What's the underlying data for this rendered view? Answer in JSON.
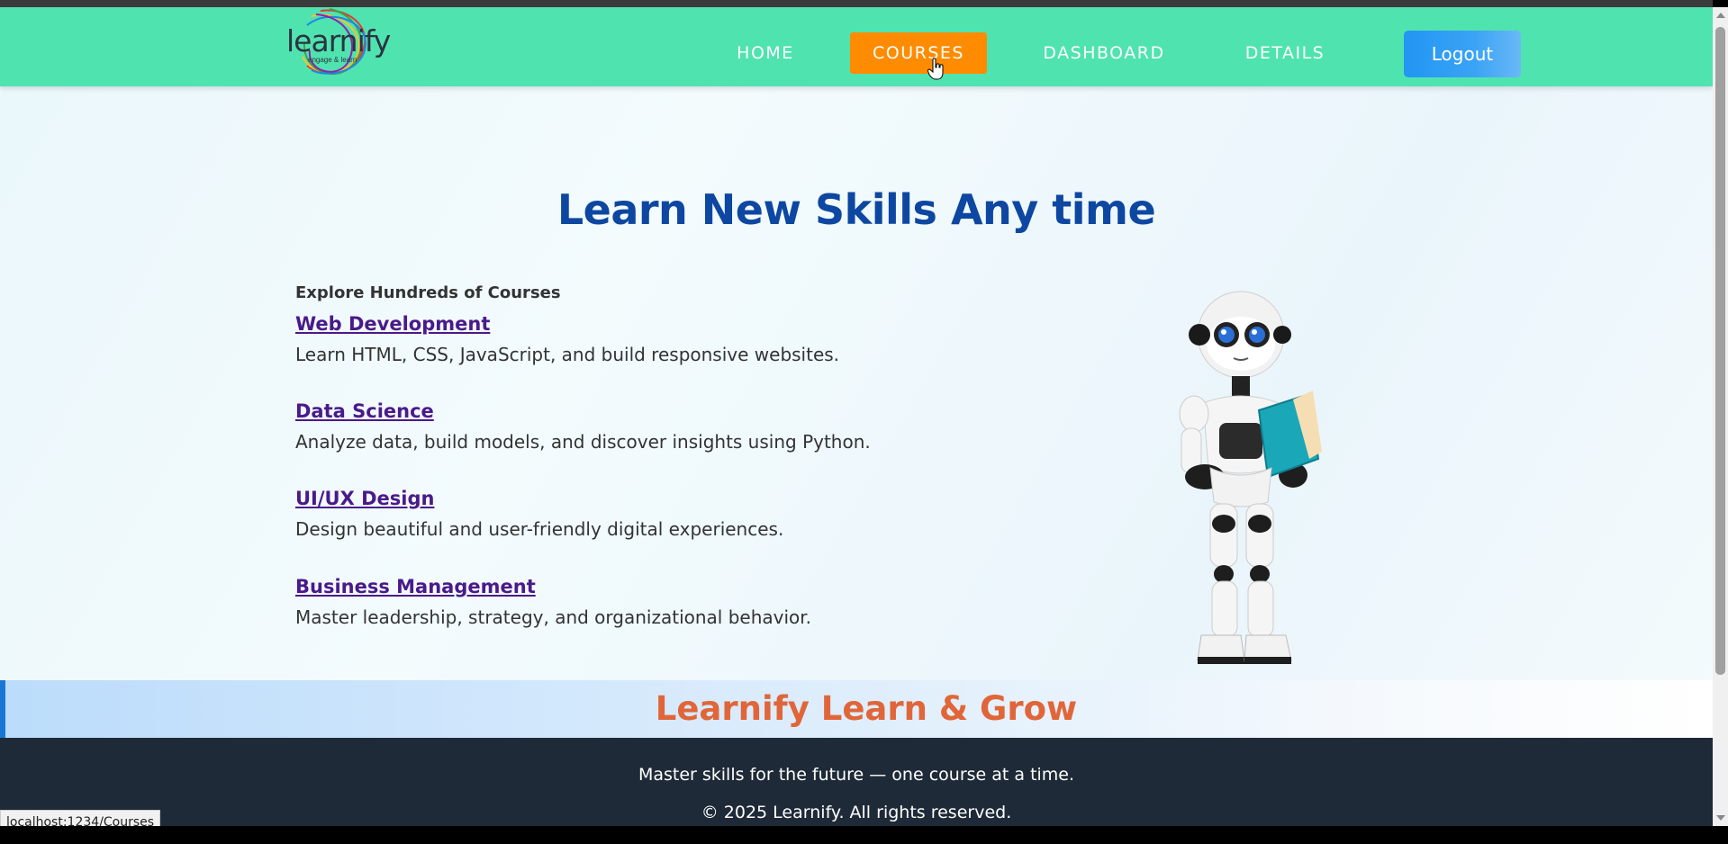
{
  "nav": {
    "logo_text": "learnify",
    "logo_tagline": "engage & learn",
    "links": [
      "HOME",
      "COURSES",
      "DASHBOARD",
      "DETAILS"
    ],
    "active": "COURSES",
    "logout_label": "Logout"
  },
  "main": {
    "title": "Learn New Skills Any time",
    "subtitle": "Explore Hundreds of Courses",
    "courses": [
      {
        "name": "Web Development",
        "description": "Learn HTML, CSS, JavaScript, and build responsive websites."
      },
      {
        "name": "Data Science",
        "description": "Analyze data, build models, and discover insights using Python."
      },
      {
        "name": "UI/UX Design",
        "description": "Design beautiful and user-friendly digital experiences."
      },
      {
        "name": "Business Management",
        "description": "Master leadership, strategy, and organizational behavior."
      }
    ]
  },
  "banner": {
    "title": "Learnify Learn & Grow"
  },
  "footer": {
    "tagline": "Master skills for the future — one course at a time.",
    "copyright": "© 2025 Learnify. All rights reserved."
  },
  "status_bar": {
    "url": "localhost:1234/Courses"
  },
  "colors": {
    "nav_bg": "#4fe3b0",
    "active_tab": "#ff8c00",
    "title": "#0d47a1",
    "link": "#4a1a8a",
    "banner_title": "#e0663a",
    "footer_bg": "#1f2a38",
    "logout": "#2196f3"
  }
}
